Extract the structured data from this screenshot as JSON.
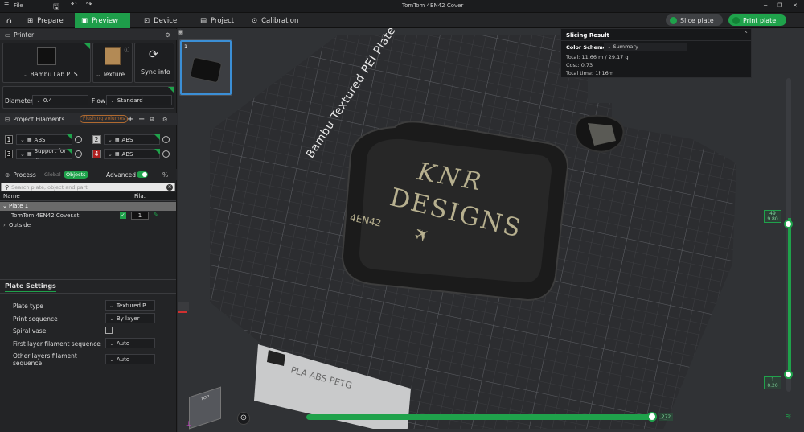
{
  "title_bar": {
    "file_label": "File",
    "window_title": "TomTom 4EN42 Cover"
  },
  "nav": {
    "tabs": [
      {
        "label": "Prepare"
      },
      {
        "label": "Preview"
      },
      {
        "label": "Device"
      },
      {
        "label": "Project"
      },
      {
        "label": "Calibration"
      }
    ],
    "slice_label": "Slice plate",
    "print_label": "Print plate"
  },
  "printer": {
    "section_title": "Printer",
    "printer_name": "Bambu Lab P1S",
    "plate_name": "Texture...",
    "sync_label": "Sync info",
    "diameter_label": "Diameter",
    "diameter_value": "0.4",
    "flow_label": "Flow",
    "flow_value": "Standard"
  },
  "filaments": {
    "section_title": "Project Filaments",
    "flushing_label": "Flushing volumes",
    "items": [
      {
        "num": "1",
        "name": "ABS",
        "color": "#111111"
      },
      {
        "num": "2",
        "name": "ABS",
        "color": "#c9c9c9"
      },
      {
        "num": "3",
        "name": "Support for ...",
        "color": "#111111"
      },
      {
        "num": "4",
        "name": "ABS",
        "color": "#b02020"
      }
    ]
  },
  "process": {
    "section_title": "Process",
    "global_label": "Global",
    "objects_label": "Objects",
    "advanced_label": "Advanced",
    "search_placeholder": "Search plate, object and part",
    "col_name": "Name",
    "col_fila": "Fila.",
    "plate_row": "Plate 1",
    "object_row": "TomTom 4EN42 Cover.stl",
    "object_fila": "1",
    "outside_row": "Outside"
  },
  "plate_settings": {
    "title": "Plate Settings",
    "rows": [
      {
        "label": "Plate type",
        "value": "Textured P..."
      },
      {
        "label": "Print sequence",
        "value": "By layer"
      },
      {
        "label": "Spiral vase",
        "value": ""
      },
      {
        "label": "First layer filament sequence",
        "value": "Auto"
      },
      {
        "label": "Other layers filament sequence",
        "value": "Auto"
      }
    ]
  },
  "slicing_result": {
    "title": "Slicing Result",
    "color_scheme_label": "Color Scheme",
    "color_scheme_value": "Summary",
    "total": "Total: 11.66 m / 29.17 g",
    "cost": "Cost: 0.73",
    "total_time": "Total time: 1h16m"
  },
  "viewport": {
    "plate_label": "Bambu Textured PEI Plate",
    "print_text_line1": "KNR",
    "print_text_line2": "DESIGNS",
    "print_text_small": "4EN42",
    "plate_strip_text": "PLA ABS PETG",
    "layer_top": "49",
    "layer_top_z": "9.80",
    "layer_bottom": "1",
    "layer_bottom_z": "0.20",
    "move_value": "272",
    "thumb_number": "1"
  },
  "colors": {
    "accent": "#1fa24b"
  }
}
